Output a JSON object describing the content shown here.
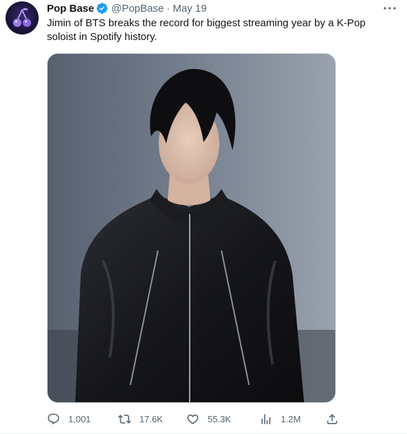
{
  "tweet": {
    "author": {
      "display_name": "Pop Base",
      "handle": "@PopBase",
      "verified": true,
      "avatar_icon": "cherries-logo-icon"
    },
    "separator": "·",
    "date": "May 19",
    "text": "Jimin of BTS breaks the record for biggest streaming year by a K-Pop soloist in Spotify history.",
    "media": {
      "type": "photo",
      "description_icon": "portrait-photo"
    },
    "actions": {
      "replies": "1,001",
      "retweets": "17.6K",
      "likes": "55.3K",
      "views": "1.2M"
    }
  },
  "colors": {
    "text_primary": "#0f1419",
    "text_secondary": "#536471",
    "verified_blue": "#1d9bf0",
    "border": "#cfd9de"
  }
}
